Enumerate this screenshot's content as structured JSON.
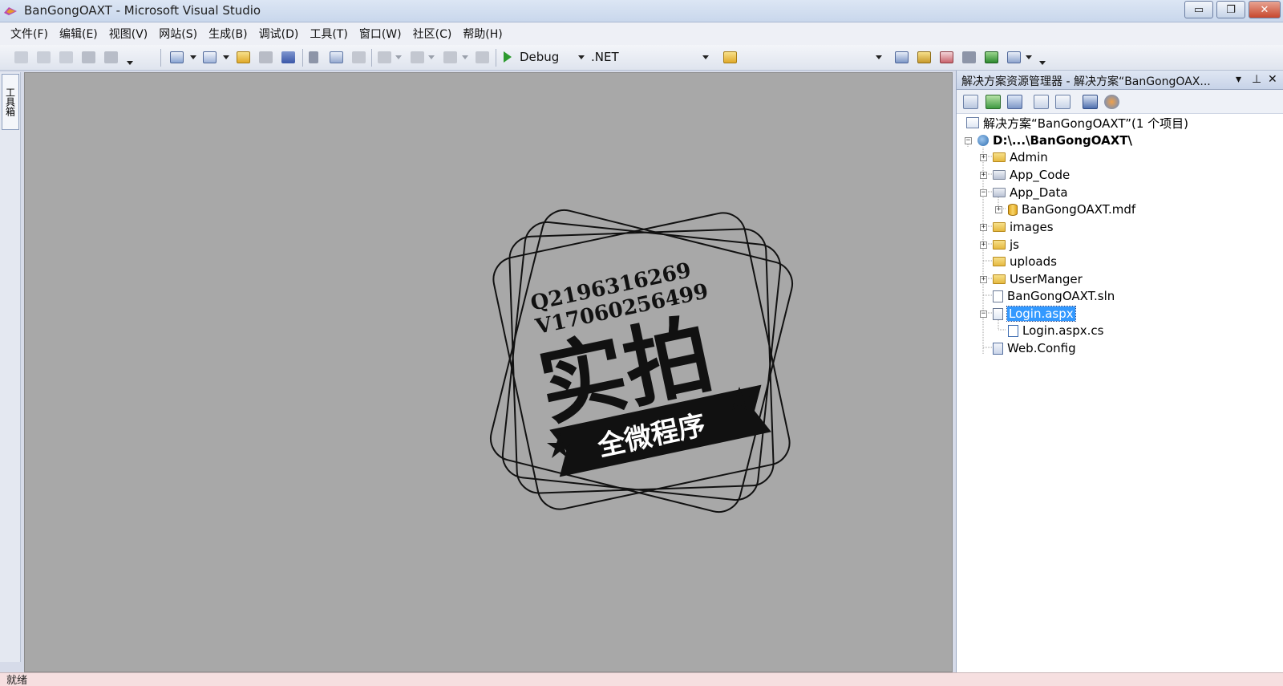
{
  "window": {
    "title": "BanGongOAXT - Microsoft Visual Studio",
    "minimize_glyph": "▭",
    "restore_glyph": "❐",
    "close_glyph": "✕"
  },
  "menu": [
    "文件(F)",
    "编辑(E)",
    "视图(V)",
    "网站(S)",
    "生成(B)",
    "调试(D)",
    "工具(T)",
    "窗口(W)",
    "社区(C)",
    "帮助(H)"
  ],
  "toolbar": {
    "config": "Debug",
    "platform": ".NET"
  },
  "toolbox": {
    "label": "工具箱"
  },
  "watermark": {
    "line1": "Q2196316269",
    "line2": "V17060256499",
    "big": "实拍",
    "banner": "全微程序"
  },
  "solution_explorer": {
    "title": "解决方案资源管理器 - 解决方案“BanGongOAX...",
    "pin_glyph": "⊥",
    "close_glyph": "✕",
    "tree": [
      {
        "label": "解决方案“BanGongOAXT”(1 个项目)",
        "icon": "solution-icon"
      },
      {
        "label": "D:\\...\\BanGongOAXT\\",
        "icon": "project-icon"
      },
      {
        "label": "Admin",
        "icon": "folder-icon"
      },
      {
        "label": "App_Code",
        "icon": "folder-icon"
      },
      {
        "label": "App_Data",
        "icon": "folder-icon"
      },
      {
        "label": "BanGongOAXT.mdf",
        "icon": "database-icon"
      },
      {
        "label": "images",
        "icon": "folder-icon"
      },
      {
        "label": "js",
        "icon": "folder-icon"
      },
      {
        "label": "uploads",
        "icon": "folder-icon"
      },
      {
        "label": "UserManger",
        "icon": "folder-icon"
      },
      {
        "label": "BanGongOAXT.sln",
        "icon": "file-icon"
      },
      {
        "label": "Login.aspx",
        "icon": "aspx-file-icon"
      },
      {
        "label": "Login.aspx.cs",
        "icon": "cs-file-icon"
      },
      {
        "label": "Web.Config",
        "icon": "config-file-icon"
      }
    ]
  },
  "status": {
    "text": "就绪"
  },
  "colors": {
    "selection": "#3399ff",
    "document_bg": "#a8a8a8",
    "status_bg": "#f6dfe0"
  }
}
